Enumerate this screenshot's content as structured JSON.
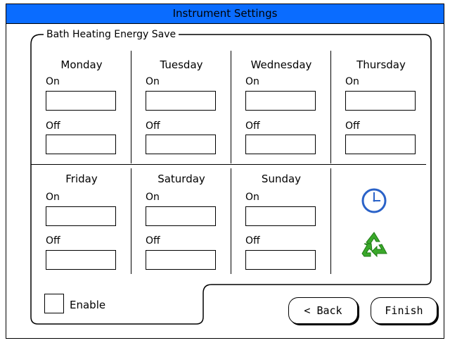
{
  "window": {
    "title": "Instrument Settings"
  },
  "group": {
    "legend": "Bath Heating Energy Save"
  },
  "days": [
    {
      "name": "Monday",
      "on_label": "On",
      "on_value": "",
      "off_label": "Off",
      "off_value": ""
    },
    {
      "name": "Tuesday",
      "on_label": "On",
      "on_value": "",
      "off_label": "Off",
      "off_value": ""
    },
    {
      "name": "Wednesday",
      "on_label": "On",
      "on_value": "",
      "off_label": "Off",
      "off_value": ""
    },
    {
      "name": "Thursday",
      "on_label": "On",
      "on_value": "",
      "off_label": "Off",
      "off_value": ""
    },
    {
      "name": "Friday",
      "on_label": "On",
      "on_value": "",
      "off_label": "Off",
      "off_value": ""
    },
    {
      "name": "Saturday",
      "on_label": "On",
      "on_value": "",
      "off_label": "Off",
      "off_value": ""
    },
    {
      "name": "Sunday",
      "on_label": "On",
      "on_value": "",
      "off_label": "Off",
      "off_value": ""
    }
  ],
  "enable": {
    "label": "Enable",
    "checked": false
  },
  "buttons": {
    "back": "< Back",
    "finish": "Finish"
  },
  "icons": {
    "clock": "clock-icon",
    "recycle": "recycle-icon"
  },
  "colors": {
    "titlebar": "#0a6cff",
    "clock": "#2a62c8",
    "recycle": "#3aa82a"
  }
}
